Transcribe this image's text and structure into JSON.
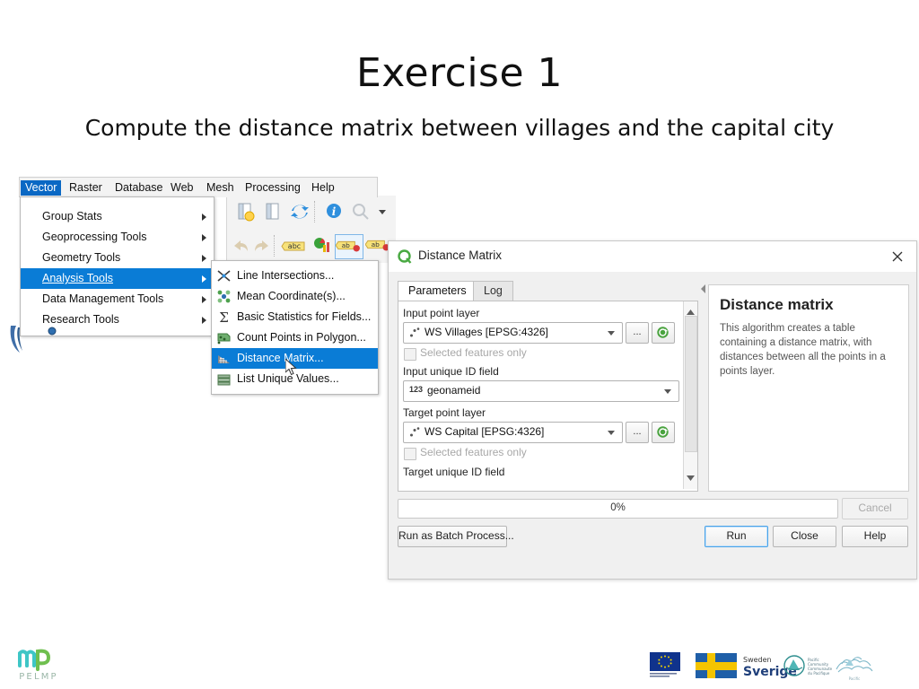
{
  "slide": {
    "title": "Exercise 1",
    "subtitle": "Compute the distance matrix between villages and the capital city"
  },
  "qgis": {
    "menubar": [
      {
        "label": "Vector",
        "selected": true
      },
      {
        "label": "Raster",
        "selected": false
      },
      {
        "label": "Database",
        "selected": false
      },
      {
        "label": "Web",
        "selected": false
      },
      {
        "label": "Mesh",
        "selected": false
      },
      {
        "label": "Processing",
        "selected": false
      },
      {
        "label": "Help",
        "selected": false
      }
    ],
    "vector_menu": [
      {
        "label": "Group Stats",
        "submenu": true,
        "highlighted": false
      },
      {
        "label": "Geoprocessing Tools",
        "submenu": true,
        "highlighted": false
      },
      {
        "label": "Geometry Tools",
        "submenu": true,
        "highlighted": false
      },
      {
        "label": "Analysis Tools",
        "submenu": true,
        "highlighted": true
      },
      {
        "label": "Data Management Tools",
        "submenu": true,
        "highlighted": false
      },
      {
        "label": "Research Tools",
        "submenu": true,
        "highlighted": false
      }
    ],
    "analysis_submenu": [
      {
        "label": "Line Intersections...",
        "icon": "line-intersections-icon",
        "highlighted": false
      },
      {
        "label": "Mean Coordinate(s)...",
        "icon": "mean-coordinates-icon",
        "highlighted": false
      },
      {
        "label": "Basic Statistics for Fields...",
        "icon": "sigma-icon",
        "highlighted": false
      },
      {
        "label": "Count Points in Polygon...",
        "icon": "count-points-icon",
        "highlighted": false
      },
      {
        "label": "Distance Matrix...",
        "icon": "distance-matrix-icon",
        "highlighted": true
      },
      {
        "label": "List Unique Values...",
        "icon": "list-unique-values-icon",
        "highlighted": false
      }
    ],
    "toolbar_icons": [
      "open-project-icon",
      "save-project-icon",
      "refresh-icon",
      "identify-features-icon",
      "zoom-select-icon",
      "dropdown-caret-icon",
      "undo-icon",
      "redo-icon",
      "label-abc-icon",
      "diagram-icon",
      "label-ab-pin-icon",
      "label-ab-unpin-icon"
    ]
  },
  "dialog": {
    "title": "Distance Matrix",
    "window_icon": "qgis-logo-icon",
    "close_icon": "close-icon",
    "tabs": [
      {
        "label": "Parameters",
        "active": true
      },
      {
        "label": "Log",
        "active": false
      }
    ],
    "fields": {
      "input_point_layer_label": "Input point layer",
      "input_point_layer_value": "WS Villages [EPSG:4326]",
      "selected_features_only_1": "Selected features only",
      "input_unique_id_label": "Input unique ID field",
      "input_unique_id_value": "geonameid",
      "input_unique_id_type": "123",
      "target_point_layer_label": "Target point layer",
      "target_point_layer_value": "WS Capital [EPSG:4326]",
      "selected_features_only_2": "Selected features only",
      "target_unique_id_label": "Target unique ID field",
      "browse_label": "...",
      "iterate_icon": "iterate-layer-icon",
      "layer_icon": "point-layer-icon"
    },
    "help": {
      "heading": "Distance matrix",
      "body": "This algorithm creates a table containing a distance matrix, with distances between all the points in a points layer."
    },
    "progress": {
      "value": "0%"
    },
    "buttons": {
      "cancel": "Cancel",
      "batch": "Run as Batch Process...",
      "run": "Run",
      "close": "Close",
      "help": "Help"
    }
  },
  "footer": {
    "logos": [
      {
        "name": "mp-pelmp-logo",
        "text": "PELMP"
      },
      {
        "name": "eu-flag-logo",
        "text": ""
      },
      {
        "name": "sweden-sverige-logo",
        "text": "Sweden Sverige"
      },
      {
        "name": "partner-circle-logo",
        "text": ""
      },
      {
        "name": "partner-sketch-logo",
        "text": ""
      }
    ]
  },
  "colors": {
    "menu_highlight": "#0a7cd6",
    "menubar_selected": "#0a68c4",
    "primary_button_border": "#4aa3e8",
    "help_text": "#555555"
  }
}
